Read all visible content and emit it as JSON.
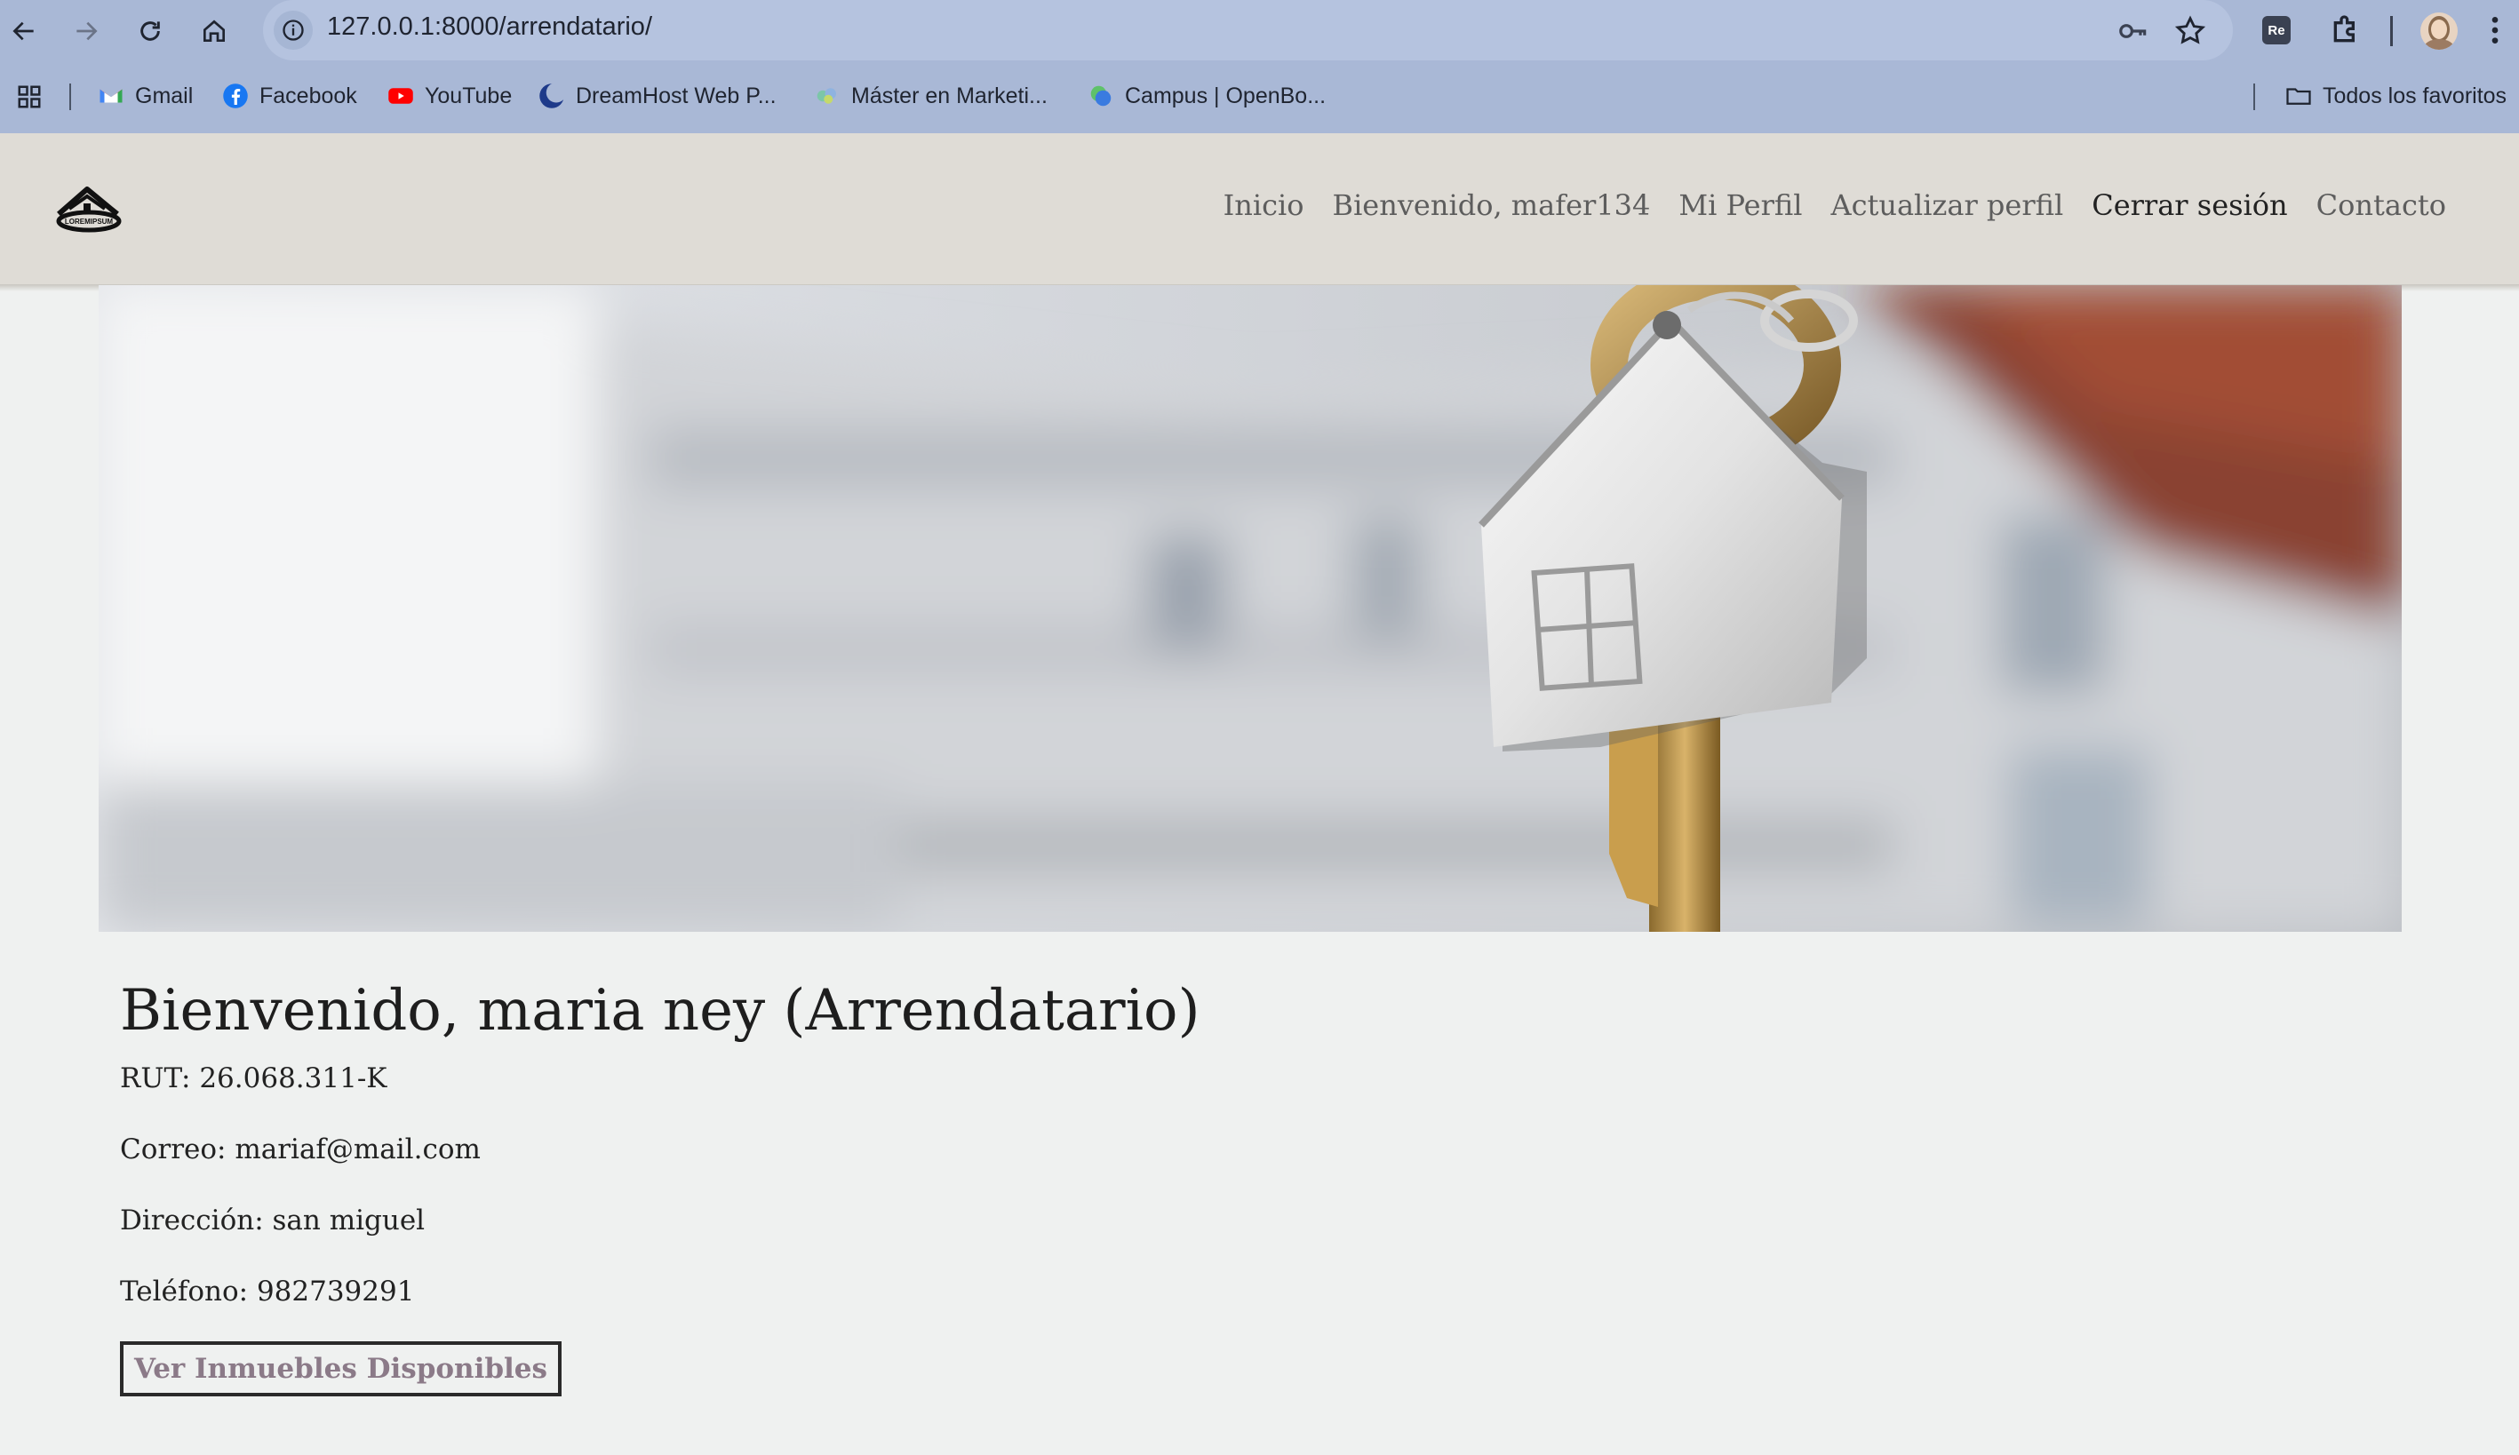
{
  "browser": {
    "url": "127.0.0.1:8000/arrendatario/",
    "bookmarks": [
      {
        "label": "Gmail",
        "icon": "gmail-icon"
      },
      {
        "label": "Facebook",
        "icon": "facebook-icon"
      },
      {
        "label": "YouTube",
        "icon": "youtube-icon"
      },
      {
        "label": "DreamHost Web P...",
        "icon": "dreamhost-icon"
      },
      {
        "label": "Máster en Marketi...",
        "icon": "master-icon"
      },
      {
        "label": "Campus | OpenBo...",
        "icon": "campus-icon"
      }
    ],
    "all_bookmarks_label": "Todos los favoritos",
    "extension_label": "Re"
  },
  "site": {
    "logo_text": "LOREMIPSUM",
    "nav": [
      {
        "label": "Inicio"
      },
      {
        "label": "Bienvenido, mafer134"
      },
      {
        "label": "Mi Perfil"
      },
      {
        "label": "Actualizar perfil"
      },
      {
        "label": "Cerrar sesión"
      },
      {
        "label": "Contacto"
      }
    ]
  },
  "profile": {
    "title": "Bienvenido, maria ney (Arrendatario)",
    "rut": "RUT: 26.068.311-K",
    "correo": "Correo: mariaf@mail.com",
    "direccion": "Dirección: san miguel",
    "telefono": "Teléfono: 982739291",
    "button_label": "Ver Inmuebles Disponibles"
  },
  "colors": {
    "chrome_bg": "#a9b8d6",
    "navbar_bg": "#dfdcd6",
    "page_bg": "#eff1f0",
    "button_text": "#8b7a88"
  }
}
